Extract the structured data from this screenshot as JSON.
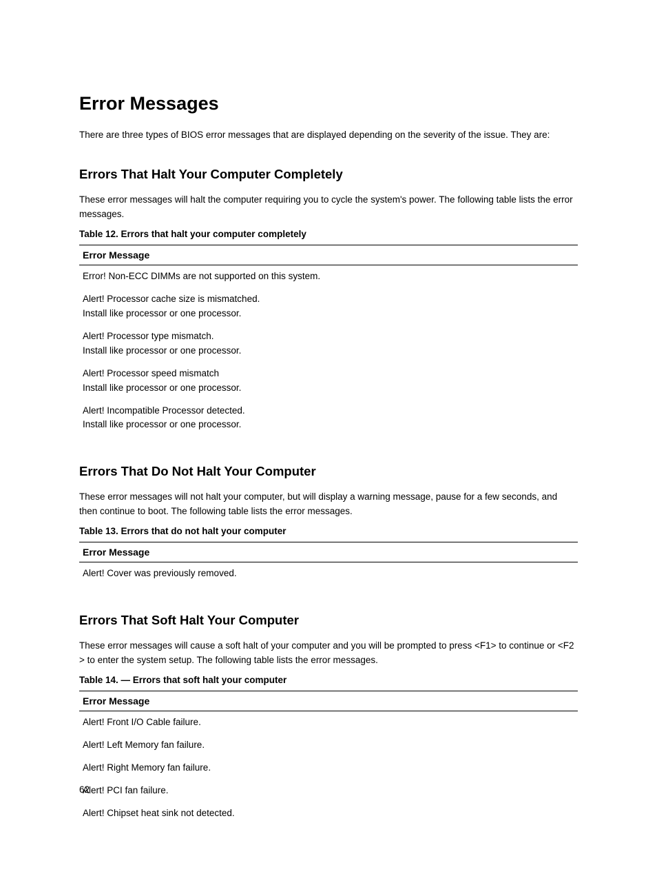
{
  "title": "Error Messages",
  "intro": "There are three types of BIOS error messages that are displayed depending on the severity of the issue. They are:",
  "sections": [
    {
      "heading": "Errors That Halt Your Computer Completely",
      "intro": "These error messages will halt the computer requiring you to cycle the system's power. The following table lists the error messages.",
      "table_caption": "Table 12. Errors that halt your computer completely",
      "table_header": "Error Message",
      "rows": [
        {
          "msg": "Error! Non-ECC DIMMs are not supported on this system."
        },
        {
          "msg": "Alert! Processor cache size is mismatched.",
          "sub": "Install like processor or one processor."
        },
        {
          "msg": "Alert! Processor type mismatch.",
          "sub": "Install like processor or one processor."
        },
        {
          "msg": "Alert! Processor speed mismatch",
          "sub": "Install like processor or one processor."
        },
        {
          "msg": "Alert! Incompatible Processor detected.",
          "sub": "Install like processor or one processor."
        }
      ]
    },
    {
      "heading": "Errors That Do Not Halt Your Computer",
      "intro": "These error messages will not halt your computer, but will display a warning message, pause for a few seconds, and then continue to boot. The following table lists the error messages.",
      "table_caption": "Table 13. Errors that do not halt your computer",
      "table_header": "Error Message",
      "rows": [
        {
          "msg": "Alert! Cover was previously removed."
        }
      ]
    },
    {
      "heading": "Errors That Soft Halt Your Computer",
      "intro": "These error messages will cause a soft halt of your computer and you will be prompted to press <F1> to continue or <F2 > to enter the system setup. The following table lists the error messages.",
      "table_caption": "Table 14. — Errors that soft halt your computer",
      "table_header": "Error Message",
      "rows": [
        {
          "msg": "Alert! Front I/O Cable failure."
        },
        {
          "msg": "Alert! Left Memory fan failure."
        },
        {
          "msg": "Alert! Right Memory fan failure."
        },
        {
          "msg": "Alert! PCI fan failure."
        },
        {
          "msg": "Alert! Chipset heat sink not detected."
        }
      ]
    }
  ],
  "page_number": "62"
}
